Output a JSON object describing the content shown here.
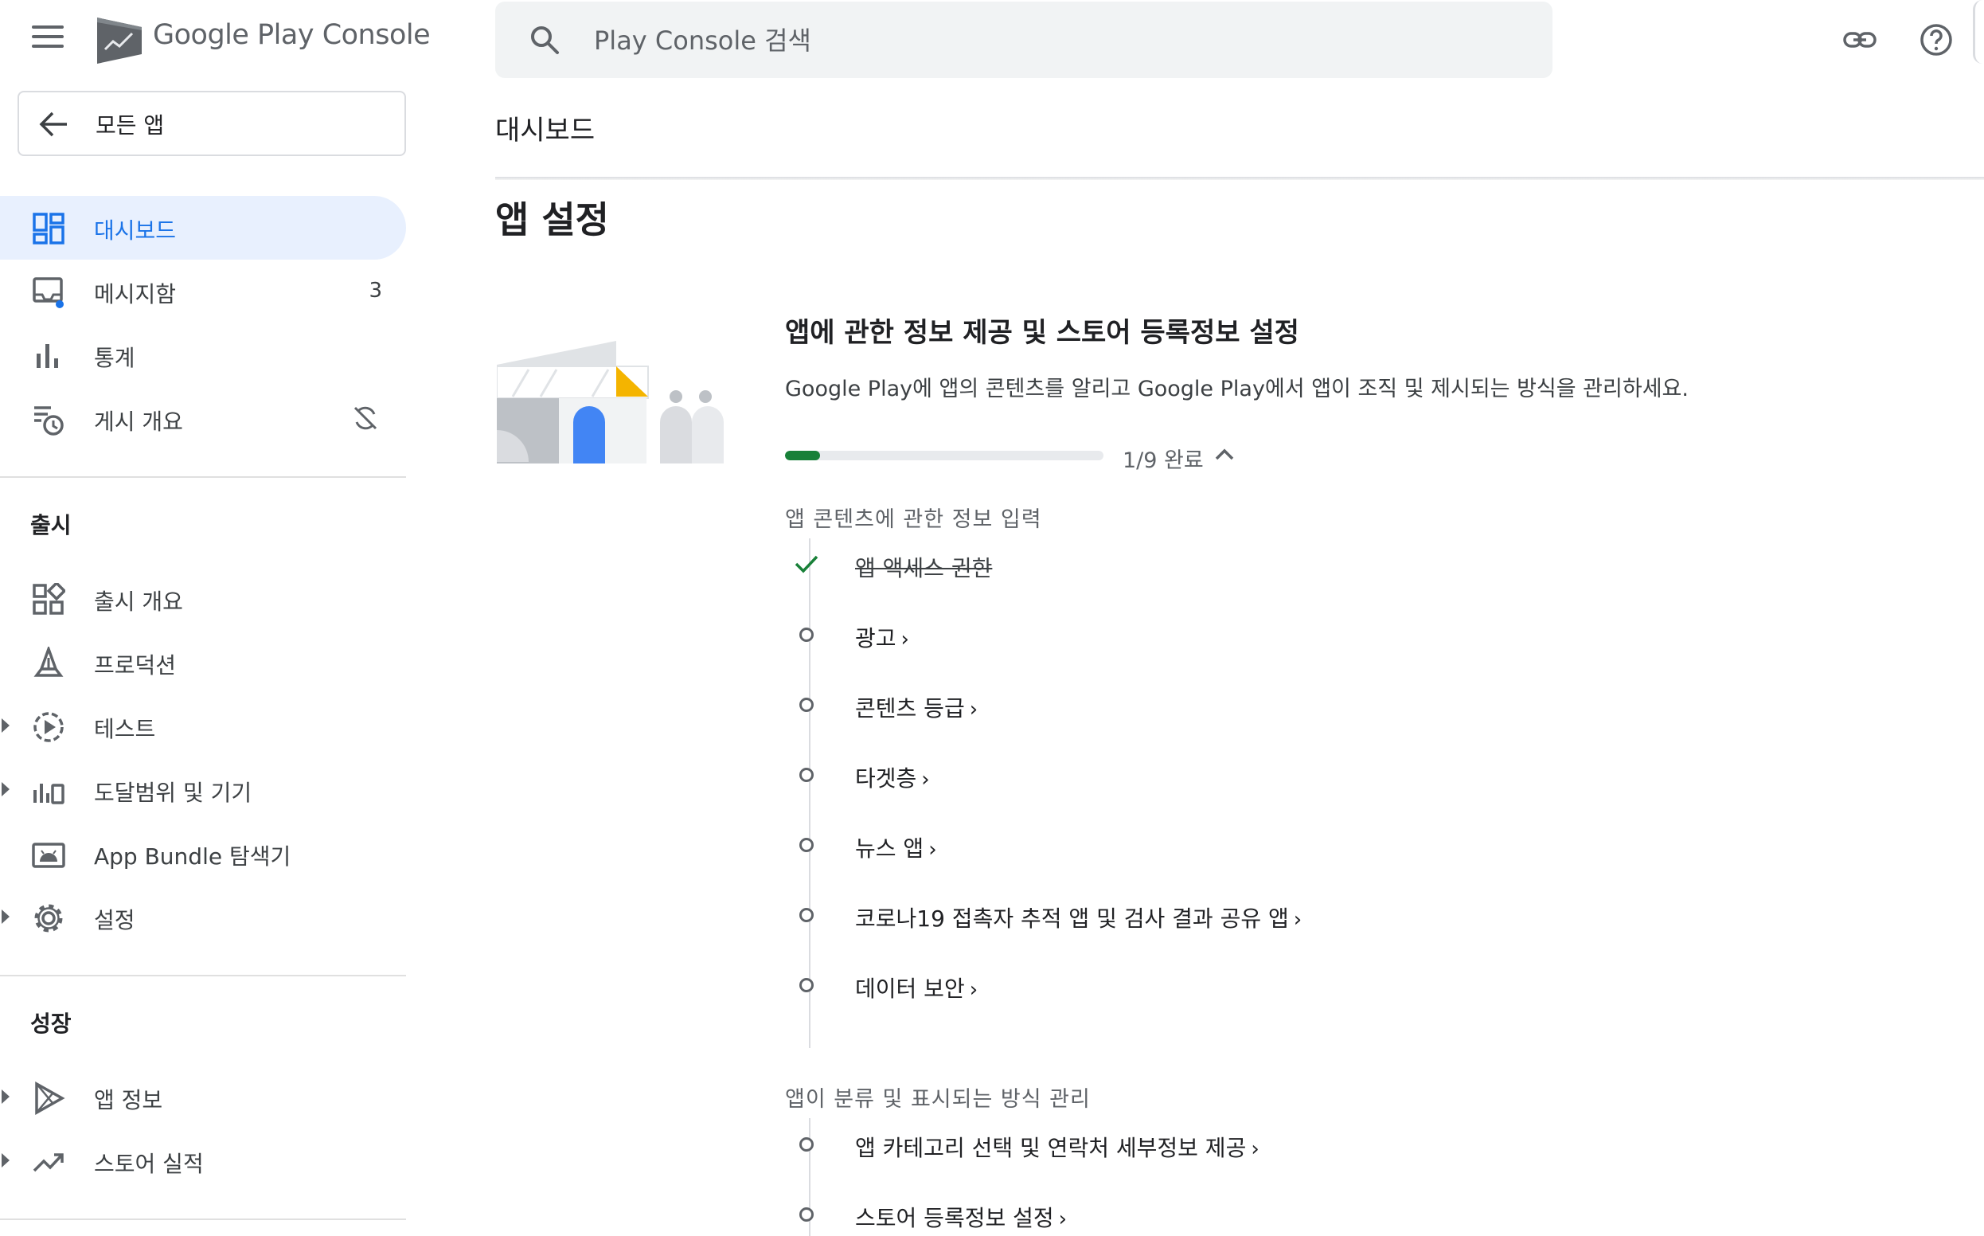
{
  "header": {
    "brand_google_play": "Google Play",
    "brand_console": "Console",
    "search_placeholder": "Play Console 검색"
  },
  "sidebar": {
    "back_label": "모든 앱",
    "top_items": [
      {
        "label": "대시보드",
        "icon": "dashboard-icon",
        "active": true
      },
      {
        "label": "메시지함",
        "icon": "inbox-icon",
        "count": "3"
      },
      {
        "label": "통계",
        "icon": "bar-chart-icon"
      },
      {
        "label": "게시 개요",
        "icon": "publishing-overview-icon"
      }
    ],
    "release_title": "출시",
    "release_items": [
      {
        "label": "출시 개요",
        "icon": "release-overview-icon"
      },
      {
        "label": "프로덕션",
        "icon": "production-icon"
      },
      {
        "label": "테스트",
        "icon": "testing-icon"
      },
      {
        "label": "도달범위 및 기기",
        "icon": "reach-devices-icon"
      },
      {
        "label": "App Bundle 탐색기",
        "icon": "android-bundle-icon"
      },
      {
        "label": "설정",
        "icon": "gear-icon"
      }
    ],
    "growth_title": "성장",
    "growth_items": [
      {
        "label": "앱 정보",
        "icon": "play-store-icon"
      },
      {
        "label": "스토어 실적",
        "icon": "trending-up-icon"
      }
    ]
  },
  "main": {
    "page_title": "대시보드",
    "section_heading": "앱 설정",
    "card": {
      "title": "앱에 관한 정보 제공 및 스토어 등록정보 설정",
      "description": "Google Play에 앱의 콘텐츠를 알리고 Google Play에서 앱이 조직 및 제시되는 방식을 관리하세요.",
      "progress_fraction": 0.111,
      "progress_text": "1/9 완료",
      "groups": [
        {
          "title": "앱 콘텐츠에 관한 정보 입력",
          "tasks": [
            {
              "label": "앱 액세스 권한",
              "done": true
            },
            {
              "label": "광고",
              "done": false
            },
            {
              "label": "콘텐츠 등급",
              "done": false
            },
            {
              "label": "타겟층",
              "done": false
            },
            {
              "label": "뉴스 앱",
              "done": false
            },
            {
              "label": "코로나19 접촉자 추적 앱 및 검사 결과 공유 앱",
              "done": false
            },
            {
              "label": "데이터 보안",
              "done": false
            }
          ]
        },
        {
          "title": "앱이 분류 및 표시되는 방식 관리",
          "tasks": [
            {
              "label": "앱 카테고리 선택 및 연락처 세부정보 제공",
              "done": false
            },
            {
              "label": "스토어 등록정보 설정",
              "done": false
            }
          ]
        }
      ]
    }
  },
  "colors": {
    "accent": "#1a73e8",
    "active_bg": "#e8f0fe",
    "progress": "#188038",
    "illustration_yellow": "#f4b400"
  }
}
